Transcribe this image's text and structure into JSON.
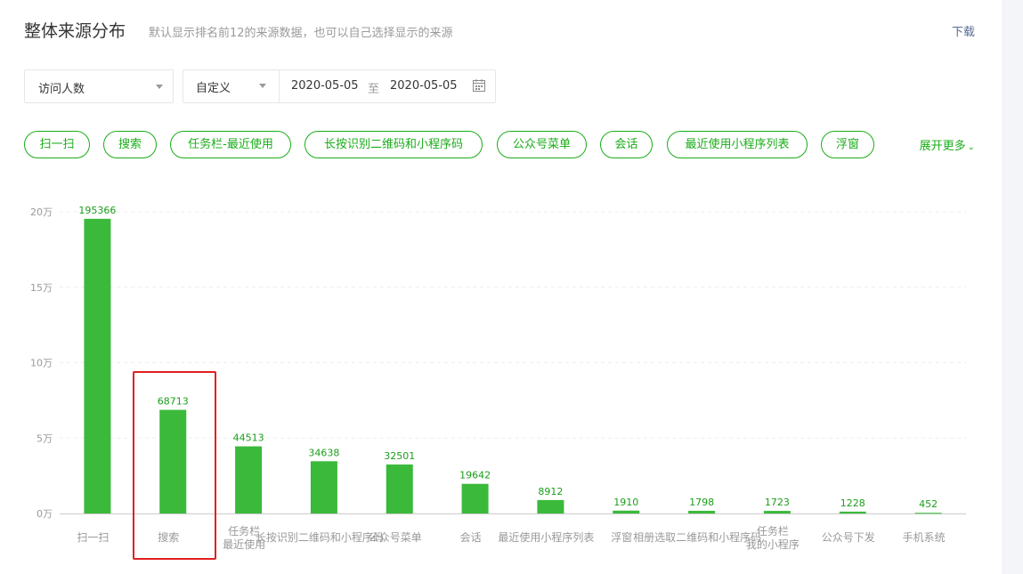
{
  "header": {
    "title": "整体来源分布",
    "subtitle": "默认显示排名前12的来源数据，也可以自己选择显示的来源",
    "download_label": "下载"
  },
  "filters": {
    "metric": "访问人数",
    "range_type": "自定义",
    "date_start": "2020-05-05",
    "date_separator": "至",
    "date_end": "2020-05-05"
  },
  "chips": [
    {
      "label": "扫一扫"
    },
    {
      "label": "搜索"
    },
    {
      "label": "任务栏-最近使用"
    },
    {
      "label": "长按识别二维码和小程序码"
    },
    {
      "label": "公众号菜单"
    },
    {
      "label": "会话"
    },
    {
      "label": "最近使用小程序列表"
    },
    {
      "label": "浮窗"
    }
  ],
  "expand_label": "展开更多",
  "colors": {
    "accent": "#1aad19",
    "bar": "#3bb93b",
    "highlight": "#e02020",
    "link": "#576b95"
  },
  "chart_data": {
    "type": "bar",
    "categories": [
      [
        "扫一扫"
      ],
      [
        "搜索"
      ],
      [
        "任务栏",
        "最近使用"
      ],
      [
        "长按识别二维码和小程序码"
      ],
      [
        "公众号菜单"
      ],
      [
        "会话"
      ],
      [
        "最近使用小程序列表"
      ],
      [
        "浮窗"
      ],
      [
        "相册选取二维码和小程序码"
      ],
      [
        "任务栏",
        "我的小程序"
      ],
      [
        "公众号下发"
      ],
      [
        "手机系统"
      ]
    ],
    "values": [
      195366,
      68713,
      44513,
      34638,
      32501,
      19642,
      8912,
      1910,
      1798,
      1723,
      1228,
      452
    ],
    "yticks": [
      {
        "value": 0,
        "label": "0万"
      },
      {
        "value": 50000,
        "label": "5万"
      },
      {
        "value": 100000,
        "label": "10万"
      },
      {
        "value": 150000,
        "label": "15万"
      },
      {
        "value": 200000,
        "label": "20万"
      }
    ],
    "ylim": [
      0,
      200000
    ],
    "highlighted_category": "搜索",
    "grid": true
  }
}
